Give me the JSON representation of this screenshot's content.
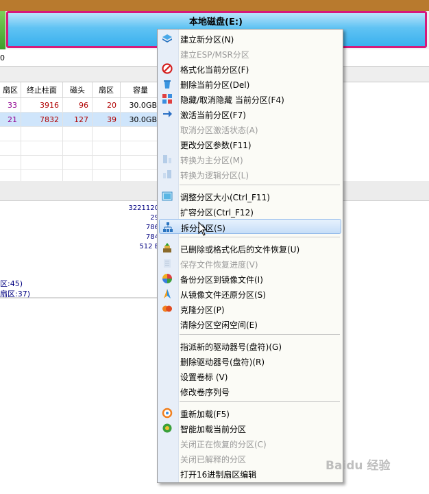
{
  "disk": {
    "partition_label": "本地磁盘(E:)",
    "left_value": "0"
  },
  "table": {
    "headers": [
      "扇区",
      "终止柱面",
      "磁头",
      "扇区",
      "容量"
    ],
    "rows": [
      {
        "c1": "33",
        "c2": "3916",
        "c3": "96",
        "c4": "20",
        "c5": "30.0GB"
      },
      {
        "c1": "21",
        "c2": "7832",
        "c3": "127",
        "c4": "39",
        "c5": "30.0GB"
      }
    ]
  },
  "info": {
    "n1": "3221120",
    "n2": "29",
    "n3": "786",
    "n4": "784",
    "n5": "512 E",
    "l1": "区:45)",
    "l2": "扇区:37)"
  },
  "menu": {
    "new_partition": "建立新分区(N)",
    "new_esp": "建立ESP/MSR分区",
    "format": "格式化当前分区(F)",
    "delete": "删除当前分区(Del)",
    "hide": "隐藏/取消隐藏 当前分区(F4)",
    "activate": "激活当前分区(F7)",
    "deactivate": "取消分区激活状态(A)",
    "change_params": "更改分区参数(F11)",
    "to_primary": "转换为主分区(M)",
    "to_logical": "转换为逻辑分区(L)",
    "resize": "调整分区大小(Ctrl_F11)",
    "extend": "扩容分区(Ctrl_F12)",
    "split": "拆分分区(S)",
    "recover_files": "已删除或格式化后的文件恢复(U)",
    "save_progress": "保存文件恢复进度(V)",
    "backup_image": "备份分区到镜像文件(I)",
    "restore_image": "从镜像文件还原分区(S)",
    "clone": "克隆分区(P)",
    "wipe_free": "清除分区空闲空间(E)",
    "assign_letter": "指派新的驱动器号(盘符)(G)",
    "remove_letter": "删除驱动器号(盘符)(R)",
    "set_label": "设置卷标 (V)",
    "change_serial": "修改卷序列号",
    "reload": "重新加载(F5)",
    "smart_load": "智能加载当前分区",
    "close_recovering": "关闭正在恢复的分区(C)",
    "close_interpreted": "关闭已解释的分区",
    "hex_editor": "打开16进制扇区编辑"
  },
  "watermark": "Baidu 经验"
}
